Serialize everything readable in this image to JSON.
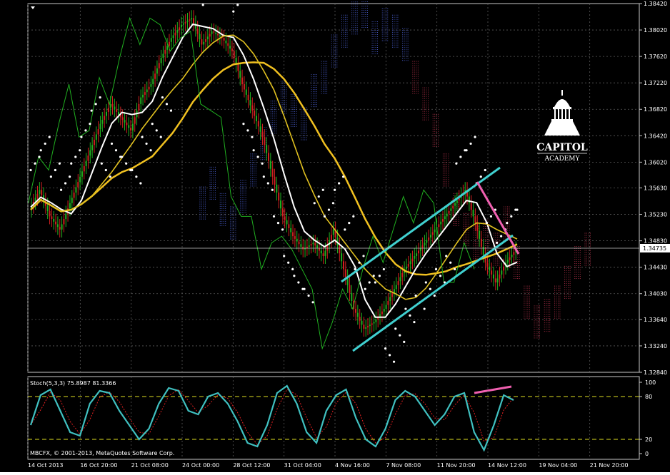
{
  "chart_data": [
    {
      "type": "candlestick",
      "symbol": "",
      "y_ticks": [
        "1.38420",
        "1.38020",
        "1.37620",
        "1.37220",
        "1.36820",
        "1.36420",
        "1.36020",
        "1.35630",
        "1.35230",
        "1.34830",
        "1.34430",
        "1.34030",
        "1.33640",
        "1.33240",
        "1.32840"
      ],
      "ylim": [
        1.3284,
        1.3842
      ],
      "current_price": "1.34735",
      "x_labels": [
        "14 Oct 2013",
        "16 Oct 20:00",
        "21 Oct 08:00",
        "24 Oct 00:00",
        "28 Oct 12:00",
        "31 Oct 04:00",
        "4 Nov 16:00",
        "7 Nov 08:00",
        "11 Nov 20:00",
        "14 Nov 12:00",
        "19 Nov 04:00",
        "21 Nov 20:00"
      ],
      "close_series": [
        1.353,
        1.356,
        1.352,
        1.35,
        1.354,
        1.358,
        1.362,
        1.366,
        1.369,
        1.367,
        1.365,
        1.37,
        1.372,
        1.376,
        1.379,
        1.381,
        1.382,
        1.378,
        1.38,
        1.379,
        1.377,
        1.372,
        1.368,
        1.364,
        1.358,
        1.352,
        1.349,
        1.347,
        1.348,
        1.346,
        1.35,
        1.344,
        1.338,
        1.335,
        1.336,
        1.338,
        1.341,
        1.344,
        1.346,
        1.348,
        1.35,
        1.352,
        1.354,
        1.356,
        1.351,
        1.345,
        1.342,
        1.345,
        1.347
      ],
      "indicators": [
        "Ichimoku Kinko Hyo",
        "Moving Average",
        "Parabolic SAR"
      ],
      "colors": {
        "background": "#000000",
        "grid": "#5a5a5a",
        "cloud_bull": "#4a5fd0",
        "cloud_bear": "#b03048",
        "ma": "#f0c020",
        "tenkan": "#ffffff",
        "kijun": "#e0c020",
        "chikou": "#20b020",
        "sar": "#ffffff",
        "channel": "#40d0d0",
        "divergence": "#f060b0",
        "candle_up": "#20b020",
        "candle_down": "#d02020"
      }
    },
    {
      "type": "line",
      "label": "Stoch(5,3,3) 75.8987 81.3366",
      "ylim": [
        0,
        100
      ],
      "y_ticks": [
        "100",
        "80",
        "20",
        "0"
      ],
      "levels": [
        80,
        20
      ],
      "main": [
        40,
        82,
        90,
        60,
        30,
        25,
        70,
        88,
        85,
        60,
        40,
        20,
        35,
        70,
        92,
        88,
        60,
        55,
        80,
        85,
        70,
        45,
        15,
        10,
        40,
        85,
        95,
        70,
        30,
        15,
        60,
        82,
        90,
        50,
        20,
        10,
        35,
        75,
        88,
        80,
        60,
        40,
        55,
        80,
        85,
        30,
        5,
        40,
        82,
        75
      ],
      "signal_last": 81.3366,
      "colors": {
        "main": "#40c0c0",
        "signal": "#e02020",
        "level": "#e0e020"
      }
    }
  ],
  "overlay": {
    "copyright": "MBCFX, © 2001-2013, MetaQuotes Software Corp.",
    "logo_line1": "CAPITOL",
    "logo_line2": "ACADEMY"
  }
}
